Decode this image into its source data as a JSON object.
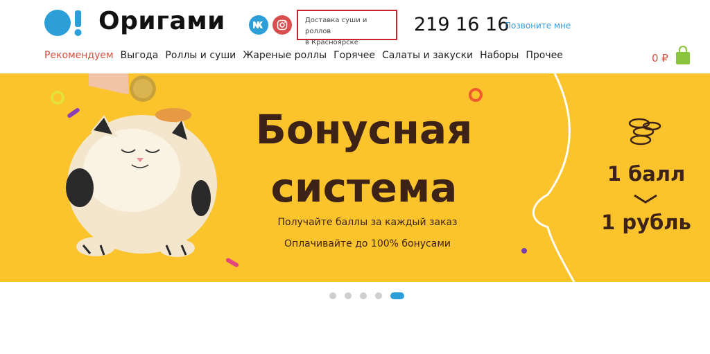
{
  "header": {
    "logo_text": "Оригами",
    "delivery_line1": "Доставка суши и роллов",
    "delivery_line2": "в Красноярске",
    "phone": "219 16 16",
    "callback_label": "Позвоните мне"
  },
  "nav": {
    "items": [
      {
        "label": "Рекомендуем"
      },
      {
        "label": "Выгода"
      },
      {
        "label": "Роллы и суши"
      },
      {
        "label": "Жареные роллы"
      },
      {
        "label": "Горячее"
      },
      {
        "label": "Салаты и закуски"
      },
      {
        "label": "Наборы"
      },
      {
        "label": "Прочее"
      }
    ],
    "active_index": 0
  },
  "cart": {
    "total": "0 ₽"
  },
  "banner": {
    "headline_line1": "Бонусная",
    "headline_line2": "система",
    "subline1": "Получайте баллы за каждый заказ",
    "subline2": "Оплачивайте до 100% бонусами",
    "rate_top": "1 балл",
    "rate_bottom": "1 рубль"
  },
  "carousel": {
    "count": 5,
    "active": 5
  },
  "colors": {
    "brand_blue": "#2d9fd8",
    "accent_red": "#d64d3e",
    "banner_yellow": "#fbc42d",
    "headline_brown": "#3d2218",
    "cart_green": "#8bc53f"
  },
  "icons": {
    "vk": "vk-icon",
    "instagram": "instagram-icon",
    "cart": "shopping-bag-icon",
    "coins": "coins-icon",
    "chevron": "chevron-down-icon"
  }
}
